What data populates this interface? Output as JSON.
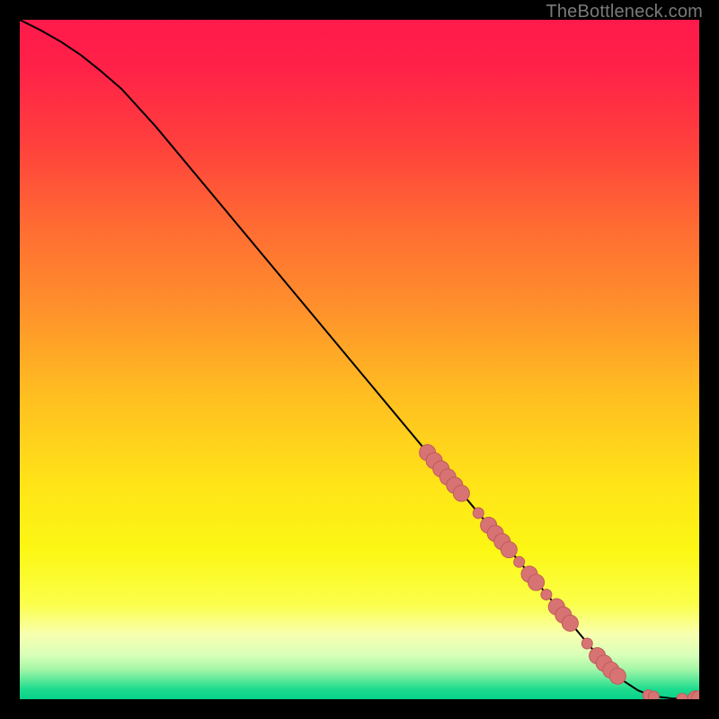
{
  "watermark": "TheBottleneck.com",
  "chart_data": {
    "type": "line",
    "title": "",
    "xlabel": "",
    "ylabel": "",
    "xlim": [
      0,
      100
    ],
    "ylim": [
      0,
      100
    ],
    "grid": false,
    "legend": false,
    "background_gradient_stops": [
      {
        "offset": 0.0,
        "color": "#ff1a4b"
      },
      {
        "offset": 0.07,
        "color": "#ff2148"
      },
      {
        "offset": 0.18,
        "color": "#ff3f3d"
      },
      {
        "offset": 0.3,
        "color": "#ff6a33"
      },
      {
        "offset": 0.42,
        "color": "#ff8f2c"
      },
      {
        "offset": 0.55,
        "color": "#ffbd21"
      },
      {
        "offset": 0.68,
        "color": "#ffe318"
      },
      {
        "offset": 0.78,
        "color": "#fcf714"
      },
      {
        "offset": 0.86,
        "color": "#fbff4a"
      },
      {
        "offset": 0.905,
        "color": "#f8ffb0"
      },
      {
        "offset": 0.935,
        "color": "#d8ffb8"
      },
      {
        "offset": 0.955,
        "color": "#a7f7a8"
      },
      {
        "offset": 0.972,
        "color": "#5be89a"
      },
      {
        "offset": 0.985,
        "color": "#1edc8e"
      },
      {
        "offset": 1.0,
        "color": "#06d18a"
      }
    ],
    "series": [
      {
        "name": "curve",
        "type": "line",
        "color": "#000000",
        "x": [
          0,
          3,
          6,
          9,
          12,
          15,
          20,
          30,
          40,
          50,
          60,
          65,
          70,
          75,
          80,
          84,
          87,
          89,
          91,
          92.5,
          94,
          96,
          98,
          100
        ],
        "y": [
          100,
          98.5,
          96.8,
          94.8,
          92.4,
          89.8,
          84.3,
          72.3,
          60.3,
          48.3,
          36.3,
          30.4,
          24.4,
          18.5,
          12.5,
          7.7,
          4.4,
          2.6,
          1.3,
          0.7,
          0.35,
          0.12,
          0.05,
          0.05
        ]
      },
      {
        "name": "markers",
        "type": "scatter",
        "color": "#d87373",
        "stroke": "#c05b5b",
        "radius_small": 6,
        "radius_large": 9,
        "points": [
          {
            "x": 60.0,
            "y": 36.3,
            "r": "large"
          },
          {
            "x": 61.0,
            "y": 35.1,
            "r": "large"
          },
          {
            "x": 62.0,
            "y": 33.9,
            "r": "large"
          },
          {
            "x": 63.0,
            "y": 32.7,
            "r": "large"
          },
          {
            "x": 64.0,
            "y": 31.5,
            "r": "large"
          },
          {
            "x": 65.0,
            "y": 30.3,
            "r": "large"
          },
          {
            "x": 67.5,
            "y": 27.4,
            "r": "small"
          },
          {
            "x": 69.0,
            "y": 25.6,
            "r": "large"
          },
          {
            "x": 70.0,
            "y": 24.4,
            "r": "large"
          },
          {
            "x": 71.0,
            "y": 23.2,
            "r": "large"
          },
          {
            "x": 72.0,
            "y": 22.0,
            "r": "large"
          },
          {
            "x": 73.5,
            "y": 20.2,
            "r": "small"
          },
          {
            "x": 75.0,
            "y": 18.4,
            "r": "large"
          },
          {
            "x": 76.0,
            "y": 17.2,
            "r": "large"
          },
          {
            "x": 77.5,
            "y": 15.4,
            "r": "small"
          },
          {
            "x": 79.0,
            "y": 13.6,
            "r": "large"
          },
          {
            "x": 80.0,
            "y": 12.4,
            "r": "large"
          },
          {
            "x": 81.0,
            "y": 11.2,
            "r": "large"
          },
          {
            "x": 83.5,
            "y": 8.2,
            "r": "small"
          },
          {
            "x": 85.0,
            "y": 6.4,
            "r": "large"
          },
          {
            "x": 86.0,
            "y": 5.3,
            "r": "large"
          },
          {
            "x": 87.0,
            "y": 4.3,
            "r": "large"
          },
          {
            "x": 88.0,
            "y": 3.4,
            "r": "large"
          },
          {
            "x": 92.5,
            "y": 0.6,
            "r": "small"
          },
          {
            "x": 93.3,
            "y": 0.4,
            "r": "small"
          },
          {
            "x": 97.5,
            "y": 0.08,
            "r": "small"
          },
          {
            "x": 99.5,
            "y": 0.05,
            "r": "large"
          },
          {
            "x": 100.0,
            "y": 0.05,
            "r": "large"
          }
        ]
      }
    ]
  }
}
